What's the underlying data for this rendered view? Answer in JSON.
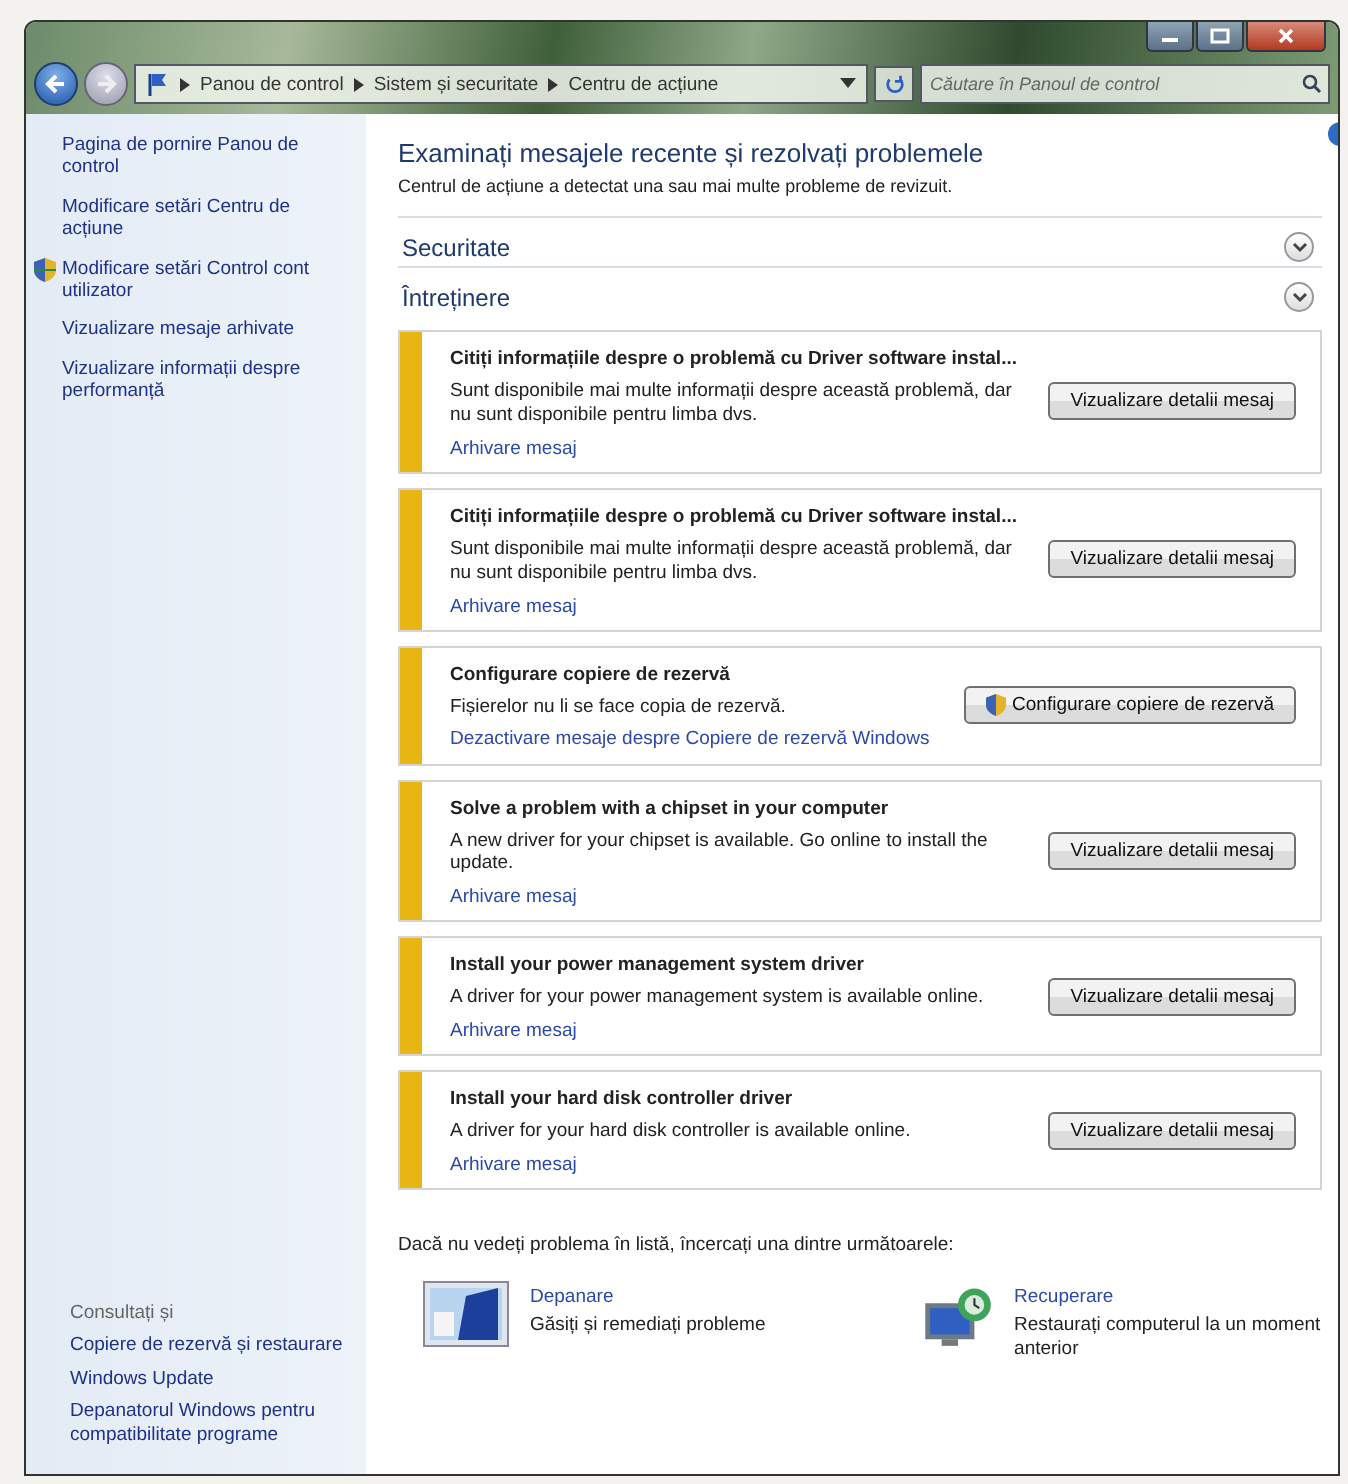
{
  "address_bar": {
    "breadcrumbs": [
      "Panou de control",
      "Sistem și securitate",
      "Centru de acțiune"
    ],
    "search": {
      "placeholder": "Căutare în Panoul de control"
    }
  },
  "sidebar": {
    "items": [
      {
        "label": "Pagina de pornire Panou de control",
        "kind": "link"
      },
      {
        "label": "Modificare setări Centru de acțiune",
        "kind": "link"
      },
      {
        "label": "Modificare setări Control cont utilizator",
        "kind": "shield"
      },
      {
        "label": "Vizualizare mesaje arhivate",
        "kind": "link"
      },
      {
        "label": "Vizualizare informații despre performanță",
        "kind": "link"
      }
    ],
    "see_also": {
      "title": "Consultați și",
      "items": [
        "Copiere de rezervă și restaurare",
        "Windows Update",
        "Depanatorul Windows pentru compatibilitate programe"
      ]
    }
  },
  "main": {
    "title": "Examinați mesajele recente și rezolvați problemele",
    "subtitle": "Centrul de acțiune a detectat una sau mai multe probleme de revizuit.",
    "sections": [
      {
        "title": "Securitate"
      },
      {
        "title": "Întreținere",
        "messages": [
          {
            "title": "Citiți informațiile despre o problemă cu Driver software instal...",
            "text": "Sunt disponibile mai multe informații despre această problemă, dar nu sunt disponibile pentru limba dvs.",
            "link": "Arhivare mesaj",
            "button": "Vizualizare detalii mesaj",
            "button_shield": false
          },
          {
            "title": "Citiți informațiile despre o problemă cu Driver software instal...",
            "text": "Sunt disponibile mai multe informații despre această problemă, dar nu sunt disponibile pentru limba dvs.",
            "link": "Arhivare mesaj",
            "button": "Vizualizare detalii mesaj",
            "button_shield": false
          },
          {
            "title": "Configurare copiere de rezervă",
            "text": "Fișierelor nu li se face copia de rezervă.",
            "link": "Dezactivare mesaje despre Copiere de rezervă Windows",
            "button": "Configurare copiere de rezervă",
            "button_shield": true
          },
          {
            "title": "Solve a problem with a chipset in your computer",
            "text": "A new driver for your chipset is available. Go online to install the update.",
            "link": "Arhivare mesaj",
            "button": "Vizualizare detalii mesaj",
            "button_shield": false
          },
          {
            "title": "Install your power management system driver",
            "text": "A driver for your power management system is available online.",
            "link": "Arhivare mesaj",
            "button": "Vizualizare detalii mesaj",
            "button_shield": false
          },
          {
            "title": "Install your hard disk controller driver",
            "text": "A driver for your hard disk controller is available online.",
            "link": "Arhivare mesaj",
            "button": "Vizualizare detalii mesaj",
            "button_shield": false
          }
        ]
      }
    ],
    "footer_text": "Dacă nu vedeți problema în listă, încercați una dintre următoarele:",
    "tools": [
      {
        "kind": "troubleshoot",
        "title": "Depanare",
        "text": "Găsiți și remediați probleme"
      },
      {
        "kind": "recovery",
        "title": "Recuperare",
        "text": "Restaurați computerul la un moment anterior"
      }
    ]
  }
}
